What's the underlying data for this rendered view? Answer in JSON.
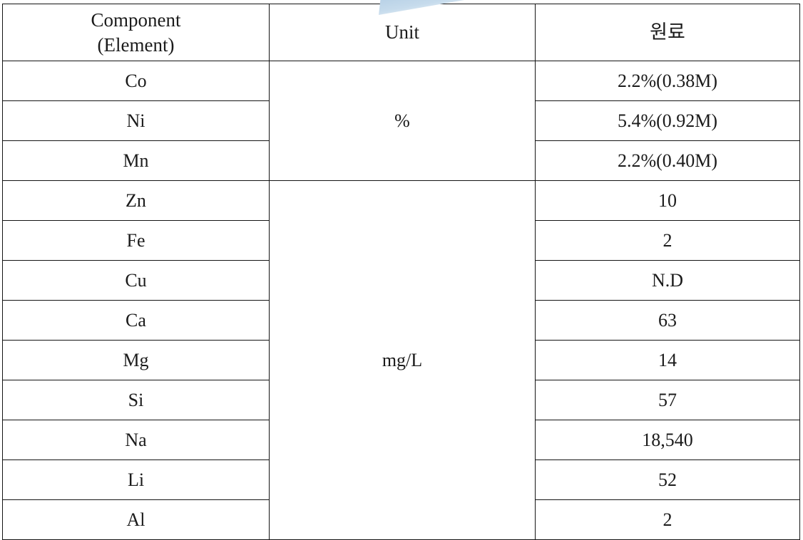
{
  "table": {
    "headers": {
      "component_line1": "Component",
      "component_line2": "(Element)",
      "unit": "Unit",
      "value": "원료"
    },
    "rows": [
      {
        "element": "Co",
        "unit": "%",
        "value": "2.2%(0.38M)"
      },
      {
        "element": "Ni",
        "unit": "%",
        "value": "5.4%(0.92M)"
      },
      {
        "element": "Mn",
        "unit": "%",
        "value": "2.2%(0.40M)"
      },
      {
        "element": "Zn",
        "unit": "mg/L",
        "value": "10"
      },
      {
        "element": "Fe",
        "unit": "mg/L",
        "value": "2"
      },
      {
        "element": "Cu",
        "unit": "mg/L",
        "value": "N.D"
      },
      {
        "element": "Ca",
        "unit": "mg/L",
        "value": "63"
      },
      {
        "element": "Mg",
        "unit": "mg/L",
        "value": "14"
      },
      {
        "element": "Si",
        "unit": "mg/L",
        "value": "57"
      },
      {
        "element": "Na",
        "unit": "mg/L",
        "value": "18,540"
      },
      {
        "element": "Li",
        "unit": "mg/L",
        "value": "52"
      },
      {
        "element": "Al",
        "unit": "mg/L",
        "value": "2"
      }
    ],
    "unit_groups": [
      {
        "label": "%",
        "span": 3
      },
      {
        "label": "mg/L",
        "span": 9
      }
    ]
  },
  "artifact": {
    "name": "scan-artifact-triangle",
    "color": "#bcd4e6"
  }
}
